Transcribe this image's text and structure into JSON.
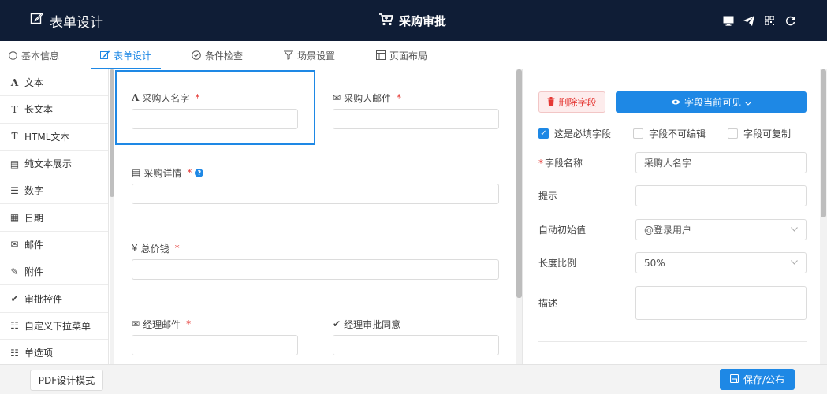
{
  "header": {
    "left_title": "表单设计",
    "center_title": "采购审批",
    "right_icons": [
      "desktop-icon",
      "send-icon",
      "qrcode-icon",
      "refresh-icon"
    ]
  },
  "tabs": [
    {
      "label": "基本信息",
      "icon": "info-icon"
    },
    {
      "label": "表单设计",
      "icon": "edit-icon"
    },
    {
      "label": "条件检查",
      "icon": "check-circle-icon"
    },
    {
      "label": "场景设置",
      "icon": "filter-icon"
    },
    {
      "label": "页面布局",
      "icon": "layout-icon"
    }
  ],
  "palette": [
    {
      "label": "文本",
      "glyph": "A"
    },
    {
      "label": "长文本",
      "glyph": "T"
    },
    {
      "label": "HTML文本",
      "glyph": "T"
    },
    {
      "label": "纯文本展示",
      "glyph": "▤"
    },
    {
      "label": "数字",
      "glyph": "☰"
    },
    {
      "label": "日期",
      "glyph": "▦"
    },
    {
      "label": "邮件",
      "glyph": "✉"
    },
    {
      "label": "附件",
      "glyph": "✎"
    },
    {
      "label": "审批控件",
      "glyph": "✔"
    },
    {
      "label": "自定义下拉菜单",
      "glyph": "☷"
    },
    {
      "label": "单选项",
      "glyph": "☷"
    }
  ],
  "canvas": {
    "fields": {
      "buyer_name": {
        "glyph": "A",
        "label": "采购人名字",
        "required": "*"
      },
      "buyer_email": {
        "glyph": "✉",
        "label": "采购人邮件",
        "required": "*"
      },
      "details": {
        "glyph": "▤",
        "label": "采购详情",
        "required": "*",
        "help": "?"
      },
      "total": {
        "glyph": "¥",
        "label": "总价钱",
        "required": "*"
      },
      "manager_email": {
        "glyph": "✉",
        "label": "经理邮件",
        "required": "*"
      },
      "manager_approve": {
        "glyph": "✔",
        "label": "经理审批同意"
      }
    }
  },
  "props": {
    "delete_label": "删除字段",
    "visibility_label": "字段当前可见",
    "checks": {
      "required": "这是必填字段",
      "not_editable": "字段不可编辑",
      "copyable": "字段可复制"
    },
    "rows": {
      "name_label": "字段名称",
      "name_required": "*",
      "name_value": "采购人名字",
      "hint_label": "提示",
      "init_label": "自动初始值",
      "init_value": "@登录用户",
      "ratio_label": "长度比例",
      "ratio_value": "50%",
      "desc_label": "描述"
    }
  },
  "footer": {
    "pdf_label": "PDF设计模式",
    "save_label": "保存/公布"
  },
  "colors": {
    "header_bg": "#0f1d36",
    "accent": "#1e88e5",
    "danger": "#e53935"
  }
}
